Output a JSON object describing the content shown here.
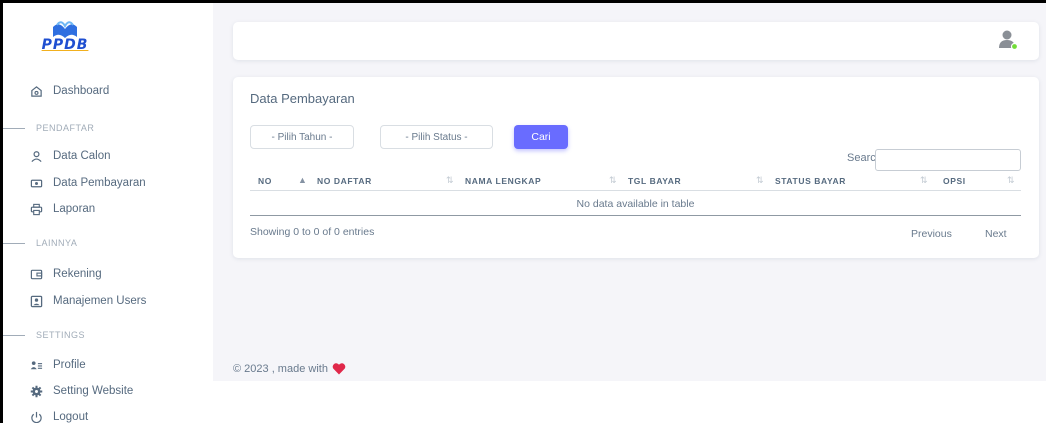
{
  "app": {
    "logo_text": "PPDB"
  },
  "sidebar": {
    "dashboard": "Dashboard",
    "section_pendaftar": "PENDAFTAR",
    "data_calon": "Data Calon",
    "data_pembayaran": "Data Pembayaran",
    "laporan": "Laporan",
    "section_lainnya": "LAINNYA",
    "rekening": "Rekening",
    "manajemen_users": "Manajemen Users",
    "section_settings": "SETTINGS",
    "profile": "Profile",
    "setting_website": "Setting Website",
    "logout": "Logout"
  },
  "main": {
    "title": "Data Pembayaran",
    "filter_tahun": "- Pilih Tahun -",
    "filter_status": "- Pilih Status -",
    "cari_label": "Cari",
    "search_label": "Search:",
    "table": {
      "columns": [
        "NO",
        "NO DAFTAR",
        "NAMA LENGKAP",
        "TGL BAYAR",
        "STATUS BAYAR",
        "OPSI"
      ],
      "empty_message": "No data available in table"
    },
    "info": "Showing 0 to 0 of 0 entries",
    "previous": "Previous",
    "next": "Next"
  },
  "footer": {
    "text": "© 2023 , made with"
  },
  "colors": {
    "primary": "#696cff",
    "logo_blue": "#1f4fd1",
    "heart": "#e0284a",
    "online": "#71dd37"
  }
}
